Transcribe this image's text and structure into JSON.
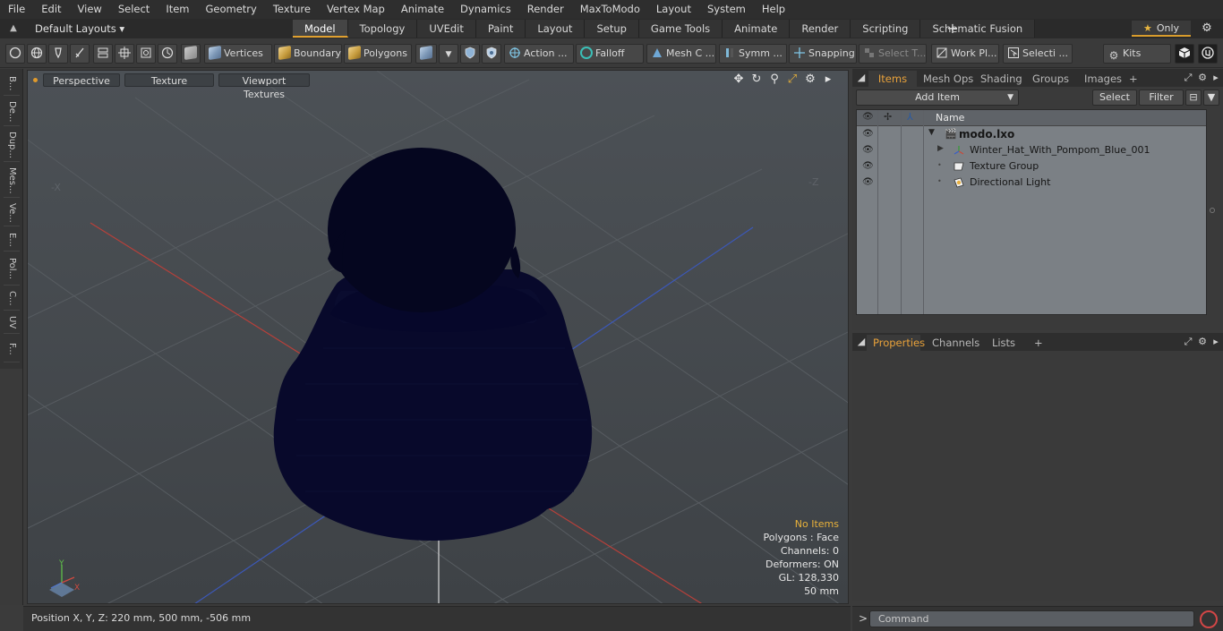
{
  "menu": [
    "File",
    "Edit",
    "View",
    "Select",
    "Item",
    "Geometry",
    "Texture",
    "Vertex Map",
    "Animate",
    "Dynamics",
    "Render",
    "MaxToModo",
    "Layout",
    "System",
    "Help"
  ],
  "layout": {
    "selector": "Default Layouts ▾"
  },
  "tabs": [
    "Model",
    "Topology",
    "UVEdit",
    "Paint",
    "Layout",
    "Setup",
    "Game Tools",
    "Animate",
    "Render",
    "Scripting",
    "Schematic Fusion"
  ],
  "tab_plus": "+",
  "only_label": "Only",
  "toolbar": {
    "vertices": "Vertices",
    "boundary": "Boundary",
    "polygons": "Polygons",
    "action": "Action",
    "falloff": "Falloff",
    "mesh_c": "Mesh C ...",
    "symm": "Symm ...",
    "snapping": "Snapping",
    "select_t": "Select T...",
    "work_pl": "Work Pl...",
    "selecti": "Selecti ...",
    "kits": "Kits"
  },
  "left_tabs": [
    "B...",
    "De...",
    "Dup...",
    "Mes...",
    "Ve...",
    "E...",
    "Pol...",
    "C...",
    "UV",
    "F..."
  ],
  "viewport": {
    "buttons": [
      "Perspective",
      "Texture",
      "Viewport Textures"
    ],
    "stats": {
      "selection": "No Items",
      "polygons": "Polygons : Face",
      "channels": "Channels: 0",
      "deformers": "Deformers: ON",
      "gl": "GL: 128,330",
      "scale": "50 mm"
    },
    "axis_labels": {
      "x": "X",
      "y": "Y",
      "neg_x": "-X",
      "neg_z": "-Z"
    }
  },
  "status": {
    "position": "Position X, Y, Z:   220 mm, 500 mm, -506 mm"
  },
  "items_panel": {
    "tabs": [
      "Items",
      "Mesh Ops",
      "Shading",
      "Groups",
      "Images"
    ],
    "plus": "+",
    "add_item": "Add Item",
    "select": "Select",
    "filter": "Filter",
    "column_name": "Name",
    "tree": [
      {
        "label": "modo.lxo"
      },
      {
        "label": "Winter_Hat_With_Pompom_Blue_001"
      },
      {
        "label": "Texture Group"
      },
      {
        "label": "Directional Light"
      }
    ]
  },
  "props_panel": {
    "tabs": [
      "Properties",
      "Channels",
      "Lists"
    ],
    "plus": "+"
  },
  "command": {
    "prompt": ">",
    "placeholder": "Command"
  },
  "colors": {
    "accent": "#e9a23a",
    "hat": "#07082a",
    "axis_red": "#b8403a",
    "axis_blue": "#3c58b8"
  }
}
